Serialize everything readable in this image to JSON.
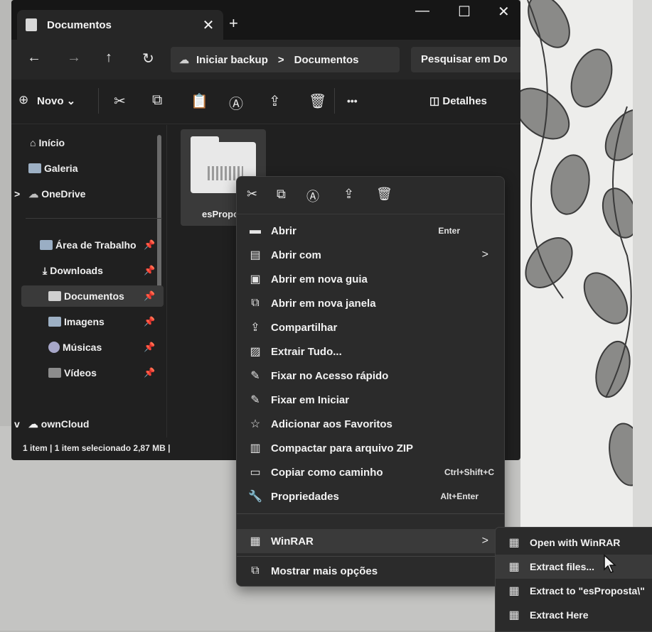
{
  "window": {
    "tab_title": "Documentos",
    "tab_close": "✕",
    "new_tab": "+",
    "minimize": "—",
    "maximize": "☐",
    "close": "✕"
  },
  "address": {
    "back": "←",
    "forward": "→",
    "up": "↑",
    "refresh": "↻",
    "crumbs": [
      "Iniciar backup",
      "Documentos"
    ],
    "separator": ">",
    "search_placeholder": "Pesquisar em Do"
  },
  "toolbar": {
    "new_label": "Novo",
    "more": "•••",
    "details_label": "Detalhes"
  },
  "sidebar": {
    "items": [
      {
        "label": "Início"
      },
      {
        "label": "Galeria"
      },
      {
        "label": "OneDrive",
        "chevron": ">"
      },
      {
        "label": "Área de Trabalho"
      },
      {
        "label": "Downloads"
      },
      {
        "label": "Documentos",
        "selected": true
      },
      {
        "label": "Imagens"
      },
      {
        "label": "Músicas"
      },
      {
        "label": "Vídeos"
      },
      {
        "label": "ownCloud",
        "chevron": "v"
      }
    ]
  },
  "file": {
    "name": "esPropo"
  },
  "status": {
    "text": "1 item  |  1 item selecionado  2,87 MB  |"
  },
  "context_menu": {
    "items": [
      {
        "label": "Abrir",
        "shortcut": "Enter"
      },
      {
        "label": "Abrir com",
        "submenu": true
      },
      {
        "label": "Abrir em nova guia"
      },
      {
        "label": "Abrir em nova janela"
      },
      {
        "label": "Compartilhar"
      },
      {
        "label": "Extrair Tudo..."
      },
      {
        "label": "Fixar no Acesso rápido"
      },
      {
        "label": "Fixar em Iniciar"
      },
      {
        "label": "Adicionar aos Favoritos"
      },
      {
        "label": "Compactar para arquivo ZIP"
      },
      {
        "label": "Copiar como caminho",
        "shortcut": "Ctrl+Shift+C"
      },
      {
        "label": "Propriedades",
        "shortcut": "Alt+Enter"
      },
      {
        "label": "WinRAR",
        "submenu": true
      },
      {
        "label": "Mostrar mais opções"
      }
    ],
    "arrow": ">"
  },
  "winrar_submenu": {
    "items": [
      {
        "label": "Open with WinRAR"
      },
      {
        "label": "Extract files..."
      },
      {
        "label": "Extract to \"esProposta\\\""
      },
      {
        "label": "Extract Here"
      }
    ]
  }
}
